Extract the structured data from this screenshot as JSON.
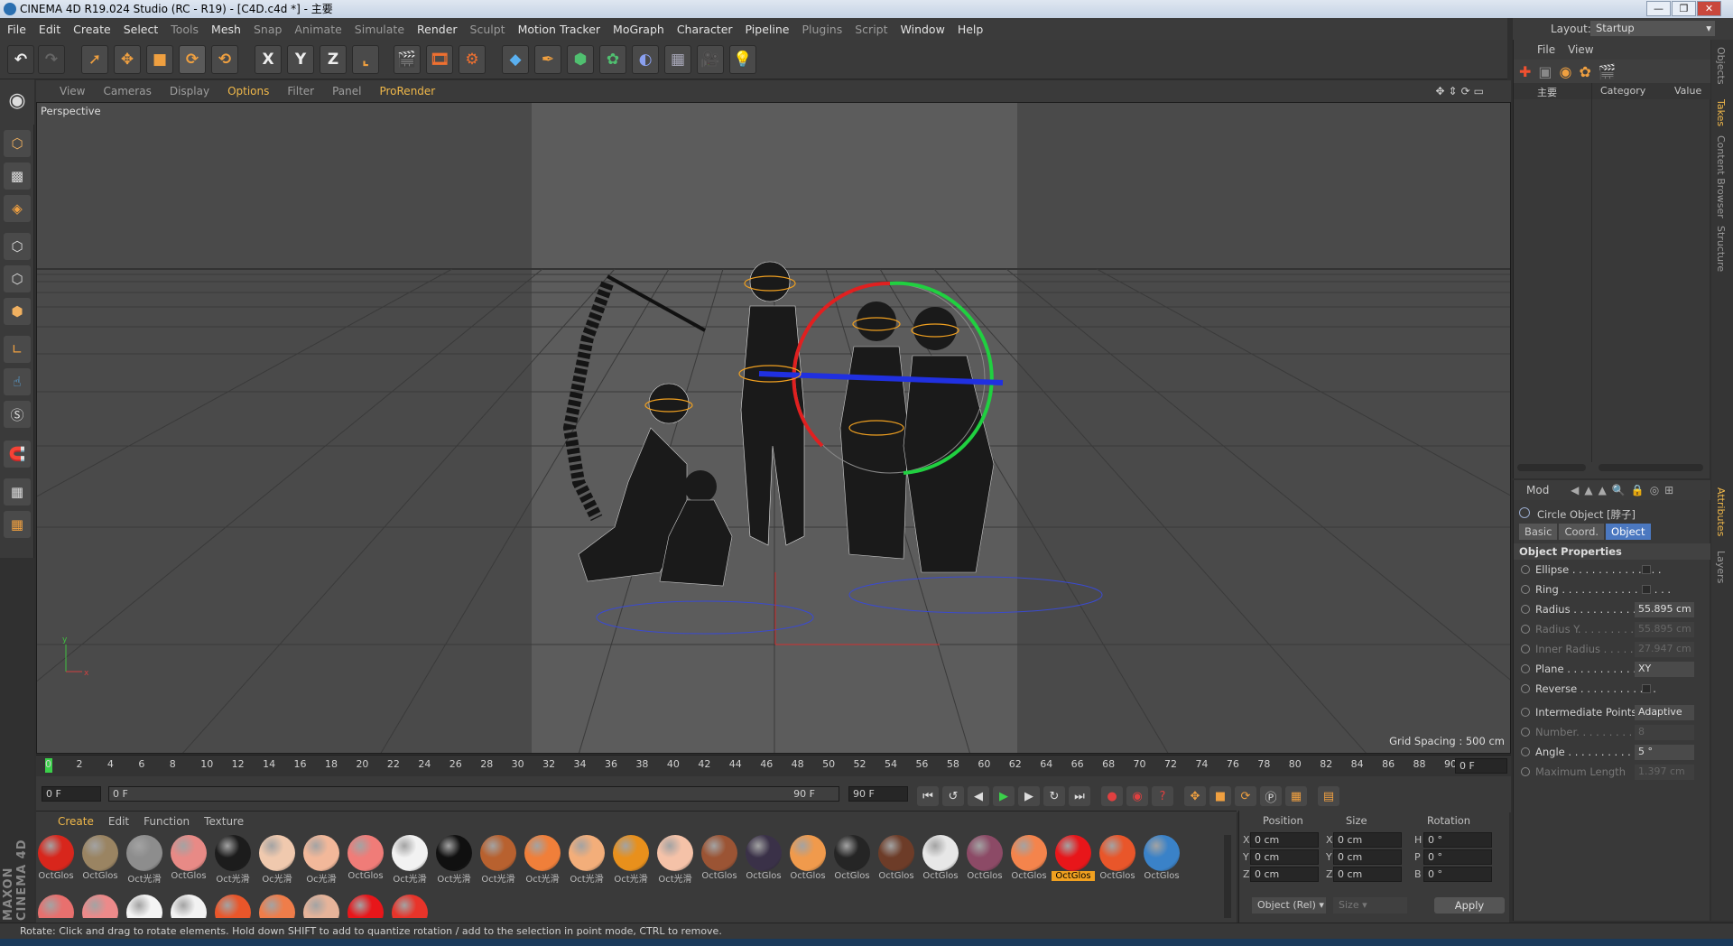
{
  "window": {
    "title": "CINEMA 4D R19.024 Studio (RC - R19) - [C4D.c4d *] - 主要",
    "min": "—",
    "max": "❐",
    "close": "✕"
  },
  "menu": [
    "File",
    "Edit",
    "Create",
    "Select",
    "Tools",
    "Mesh",
    "Snap",
    "Animate",
    "Simulate",
    "Render",
    "Sculpt",
    "Motion Tracker",
    "MoGraph",
    "Character",
    "Pipeline",
    "Plugins",
    "Script",
    "Window",
    "Help"
  ],
  "layout": {
    "label": "Layout:",
    "value": "Startup"
  },
  "toolbar": {
    "x": "X",
    "y": "Y",
    "z": "Z"
  },
  "viewport": {
    "menu": [
      "View",
      "Cameras",
      "Display",
      "Options",
      "Filter",
      "Panel",
      "ProRender"
    ],
    "active_menu": "Options",
    "title": "Perspective",
    "grid_spacing": "Grid Spacing : 500 cm"
  },
  "timeline": {
    "ticks": [
      "0",
      "2",
      "4",
      "6",
      "8",
      "10",
      "12",
      "14",
      "16",
      "18",
      "20",
      "22",
      "24",
      "26",
      "28",
      "30",
      "32",
      "34",
      "36",
      "38",
      "40",
      "42",
      "44",
      "46",
      "48",
      "50",
      "52",
      "54",
      "56",
      "58",
      "60",
      "62",
      "64",
      "66",
      "68",
      "70",
      "72",
      "74",
      "76",
      "78",
      "80",
      "82",
      "84",
      "86",
      "88",
      "90"
    ],
    "current_frame": "0 F",
    "start": "0 F",
    "range_start": "0 F",
    "range_end": "90 F",
    "end": "90 F"
  },
  "materials": {
    "menu": [
      "Create",
      "Edit",
      "Function",
      "Texture"
    ],
    "items": [
      {
        "label": "OctGlos",
        "color": "#d8261c"
      },
      {
        "label": "OctGlos",
        "color": "#9a8462"
      },
      {
        "label": "Oct光滑",
        "color": "#8d8d8d"
      },
      {
        "label": "OctGlos",
        "color": "#e88a86"
      },
      {
        "label": "Oct光滑",
        "color": "#1c1c1c"
      },
      {
        "label": "Oc光滑",
        "color": "#f0c9ae"
      },
      {
        "label": "Oc光滑",
        "color": "#f2b89a"
      },
      {
        "label": "OctGlos",
        "color": "#f07c78"
      },
      {
        "label": "Oct光滑",
        "color": "#f2f2f2"
      },
      {
        "label": "Oct光滑",
        "color": "#101010"
      },
      {
        "label": "Oct光滑",
        "color": "#b8612f"
      },
      {
        "label": "Oct光滑",
        "color": "#f07f3a"
      },
      {
        "label": "Oct光滑",
        "color": "#f3ae7a"
      },
      {
        "label": "Oct光滑",
        "color": "#e8901c"
      },
      {
        "label": "Oct光滑",
        "color": "#f5c2a8"
      },
      {
        "label": "OctGlos",
        "color": "#9b5434"
      },
      {
        "label": "OctGlos",
        "color": "#3a3148"
      },
      {
        "label": "OctGlos",
        "color": "#f09a4c"
      },
      {
        "label": "OctGlos",
        "color": "#252525"
      },
      {
        "label": "OctGlos",
        "color": "#6d3c28"
      },
      {
        "label": "OctGlos",
        "color": "#e7e7e7"
      },
      {
        "label": "OctGlos",
        "color": "#8c4a66"
      },
      {
        "label": "OctGlos",
        "color": "#f4844c"
      },
      {
        "label": "OctGlos",
        "color": "#e8161a"
      },
      {
        "label": "OctGlos",
        "color": "#e9562a"
      },
      {
        "label": "OctGlos",
        "color": "#3a82c8"
      }
    ],
    "row2": [
      "#e8706e",
      "#ec8a8a",
      "#f4f4f4",
      "#f2f2f2",
      "#e9562a",
      "#ef7d4a",
      "#e6b49a",
      "#e8161a",
      "#e8342a"
    ],
    "selected_index": 23
  },
  "coords": {
    "headers": {
      "position": "Position",
      "size": "Size",
      "rotation": "Rotation"
    },
    "rows": [
      {
        "axis": "X",
        "pos": "0 cm",
        "saxis": "X",
        "size": "0 cm",
        "raxis": "H",
        "rot": "0 °"
      },
      {
        "axis": "Y",
        "pos": "0 cm",
        "saxis": "Y",
        "size": "0 cm",
        "raxis": "P",
        "rot": "0 °"
      },
      {
        "axis": "Z",
        "pos": "0 cm",
        "saxis": "Z",
        "size": "0 cm",
        "raxis": "B",
        "rot": "0 °"
      }
    ],
    "mode": "Object (Rel)",
    "size_mode": "Size",
    "apply": "Apply"
  },
  "objects_panel": {
    "menu": [
      "File",
      "View"
    ],
    "col_name": "主要",
    "col_category": "Category",
    "col_value": "Value"
  },
  "attributes": {
    "mode": "Mod",
    "object": "Circle Object [脖子]",
    "tabs": [
      "Basic",
      "Coord.",
      "Object"
    ],
    "active_tab": "Object",
    "section": "Object Properties",
    "props": [
      {
        "name": "Ellipse . . . . . . . . . . . . . .",
        "type": "check"
      },
      {
        "name": "Ring . . . . . . . . . . . . . . . . .",
        "type": "check"
      },
      {
        "name": "Radius . . . . . . . . . . . . .",
        "type": "value",
        "value": "55.895 cm"
      },
      {
        "name": "Radius Y. . . . . . . . . . . .",
        "type": "value",
        "value": "55.895 cm",
        "disabled": true
      },
      {
        "name": "Inner Radius . . . . . . . .",
        "type": "value",
        "value": "27.947 cm",
        "disabled": true
      },
      {
        "name": "Plane . . . . . . . . . . . . . .",
        "type": "value",
        "value": "XY"
      },
      {
        "name": "Reverse . . . . . . . . . . . .",
        "type": "check"
      },
      {
        "name": "Intermediate Points",
        "type": "value",
        "value": "Adaptive"
      },
      {
        "name": "Number. . . . . . . . . . . . . .",
        "type": "value",
        "value": "8",
        "disabled": true
      },
      {
        "name": "Angle . . . . . . . . . . . . . .",
        "type": "value",
        "value": "5 °"
      },
      {
        "name": "Maximum Length",
        "type": "value",
        "value": "1.397 cm",
        "disabled": true
      }
    ]
  },
  "side_tabs": [
    "Objects",
    "Takes",
    "Content Browser",
    "Structure",
    "Attributes",
    "Layers"
  ],
  "status": "Rotate: Click and drag to rotate elements. Hold down SHIFT to add to quantize rotation / add to the selection in point mode, CTRL to remove.",
  "maxon": "MAXON CINEMA 4D"
}
